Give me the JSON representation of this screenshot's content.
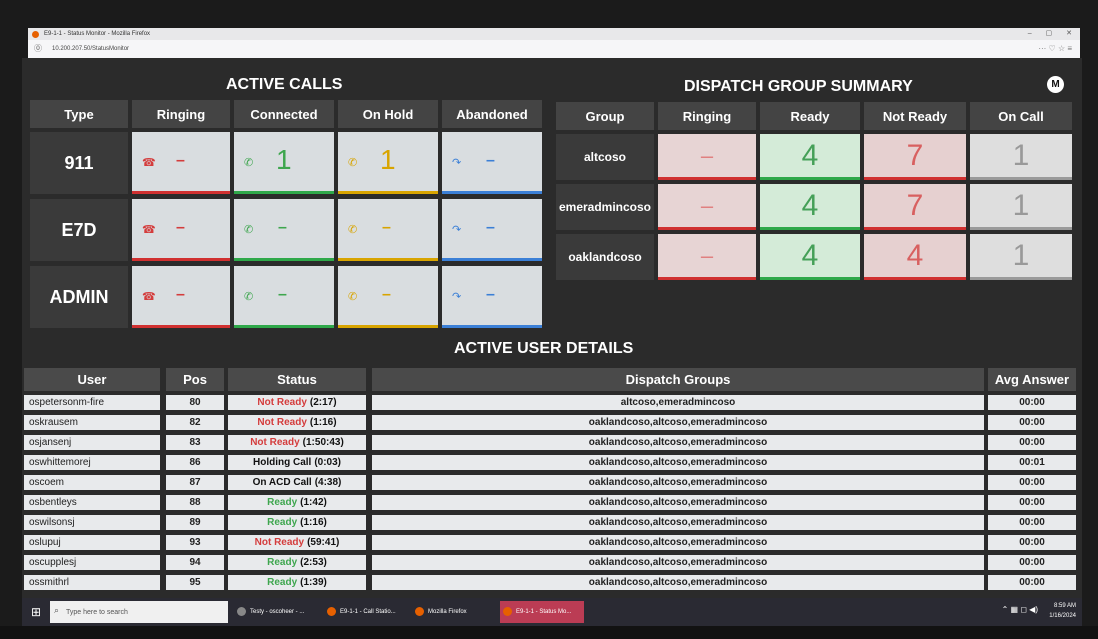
{
  "browser": {
    "title": "E9-1-1 - Status Monitor - Mozilla Firefox",
    "url": "10.200.207.50/StatusMonitor",
    "window_controls": [
      "–",
      "▢",
      "✕"
    ],
    "tools": "··· ♡ ☆ ≡"
  },
  "active_calls": {
    "title": "ACTIVE CALLS",
    "columns": [
      "Type",
      "Ringing",
      "Connected",
      "On Hold",
      "Abandoned"
    ],
    "rows": [
      {
        "type": "911",
        "ringing": "–",
        "connected": "1",
        "on_hold": "1",
        "abandoned": "–"
      },
      {
        "type": "E7D",
        "ringing": "–",
        "connected": "–",
        "on_hold": "–",
        "abandoned": "–"
      },
      {
        "type": "ADMIN",
        "ringing": "–",
        "connected": "–",
        "on_hold": "–",
        "abandoned": "–"
      }
    ],
    "icons": {
      "ringing": "phone-ringing-icon",
      "connected": "phone-connected-icon",
      "on_hold": "phone-hold-icon",
      "abandoned": "phone-abandoned-icon"
    }
  },
  "dispatch_summary": {
    "title": "DISPATCH GROUP SUMMARY",
    "columns": [
      "Group",
      "Ringing",
      "Ready",
      "Not Ready",
      "On Call"
    ],
    "rows": [
      {
        "group": "altcoso",
        "ringing": "–",
        "ready": "4",
        "not_ready": "7",
        "on_call": "1"
      },
      {
        "group": "emeradmincoso",
        "ringing": "–",
        "ready": "4",
        "not_ready": "7",
        "on_call": "1"
      },
      {
        "group": "oaklandcoso",
        "ringing": "–",
        "ready": "4",
        "not_ready": "4",
        "on_call": "1"
      }
    ]
  },
  "user_details": {
    "title": "ACTIVE USER DETAILS",
    "columns": [
      "User",
      "Pos",
      "Status",
      "Dispatch Groups",
      "Avg Answer"
    ],
    "rows": [
      {
        "user": "ospetersonm-fire",
        "pos": "80",
        "status_label": "Not Ready",
        "status_time": "(2:17)",
        "status_color": "red",
        "groups": "altcoso,emeradmincoso",
        "avg": "00:00"
      },
      {
        "user": "oskrausem",
        "pos": "82",
        "status_label": "Not Ready",
        "status_time": "(1:16)",
        "status_color": "red",
        "groups": "oaklandcoso,altcoso,emeradmincoso",
        "avg": "00:00"
      },
      {
        "user": "osjansenj",
        "pos": "83",
        "status_label": "Not Ready",
        "status_time": "(1:50:43)",
        "status_color": "red",
        "groups": "oaklandcoso,altcoso,emeradmincoso",
        "avg": "00:00"
      },
      {
        "user": "oswhittemorej",
        "pos": "86",
        "status_label": "Holding Call",
        "status_time": "(0:03)",
        "status_color": "black",
        "groups": "oaklandcoso,altcoso,emeradmincoso",
        "avg": "00:01"
      },
      {
        "user": "oscoem",
        "pos": "87",
        "status_label": "On ACD Call",
        "status_time": "(4:38)",
        "status_color": "black",
        "groups": "oaklandcoso,altcoso,emeradmincoso",
        "avg": "00:00"
      },
      {
        "user": "osbentleys",
        "pos": "88",
        "status_label": "Ready",
        "status_time": "(1:42)",
        "status_color": "green",
        "groups": "oaklandcoso,altcoso,emeradmincoso",
        "avg": "00:00"
      },
      {
        "user": "oswilsonsj",
        "pos": "89",
        "status_label": "Ready",
        "status_time": "(1:16)",
        "status_color": "green",
        "groups": "oaklandcoso,altcoso,emeradmincoso",
        "avg": "00:00"
      },
      {
        "user": "oslupuj",
        "pos": "93",
        "status_label": "Not Ready",
        "status_time": "(59:41)",
        "status_color": "red",
        "groups": "oaklandcoso,altcoso,emeradmincoso",
        "avg": "00:00"
      },
      {
        "user": "oscupplesj",
        "pos": "94",
        "status_label": "Ready",
        "status_time": "(2:53)",
        "status_color": "green",
        "groups": "oaklandcoso,altcoso,emeradmincoso",
        "avg": "00:00"
      },
      {
        "user": "ossmithrl",
        "pos": "95",
        "status_label": "Ready",
        "status_time": "(1:39)",
        "status_color": "green",
        "groups": "oaklandcoso,altcoso,emeradmincoso",
        "avg": "00:00"
      }
    ]
  },
  "taskbar": {
    "search_placeholder": "Type here to search",
    "items": [
      "Testy - oscoheer - ...",
      "E9-1-1 - Call Statio...",
      "Mozilla Firefox",
      "E9-1-1 - Status Mo..."
    ],
    "time": "8:59 AM",
    "date": "1/16/2024"
  },
  "colors": {
    "red": "#d43c3c",
    "green": "#3ea64e",
    "yellow": "#d8a400",
    "blue": "#3b7fd6"
  }
}
